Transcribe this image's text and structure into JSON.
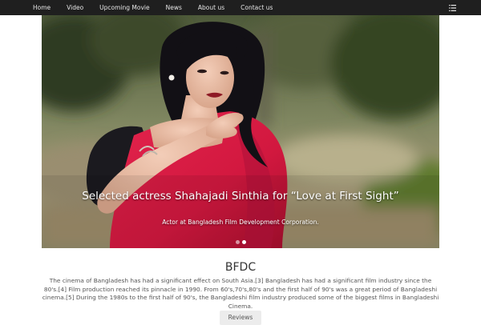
{
  "nav": {
    "items": [
      {
        "label": "Home"
      },
      {
        "label": "Video"
      },
      {
        "label": "Upcoming Movie"
      },
      {
        "label": "News"
      },
      {
        "label": "About us"
      },
      {
        "label": "Contact us"
      }
    ],
    "toggle_icon": "menu-list-icon"
  },
  "carousel": {
    "caption_title": "Selected actress Shahajadi Sinthia for “Love at First Sight”",
    "caption_subtitle": "Actor at Bangladesh Film Development Corporation.",
    "slides_count": 2,
    "active_slide": 2
  },
  "section": {
    "title": "BFDC",
    "text": "The cinema of Bangladesh has had a significant effect on South Asia.[3] Bangladesh has had a significant film industry since the 80's.[4] Film production reached its pinnacle in 1990. From 60's,70's,80's and the first half of 90's was a great period of Bangladeshi cinema.[5] During the 1980s to the first half of 90's, the Bangladeshi film industry produced some of the biggest films in Bangladeshi Cinema.",
    "button_label": "Reviews"
  },
  "colors": {
    "navbar": "#1f1f1f",
    "saree": "#d2183f",
    "background": "#ffffff"
  }
}
